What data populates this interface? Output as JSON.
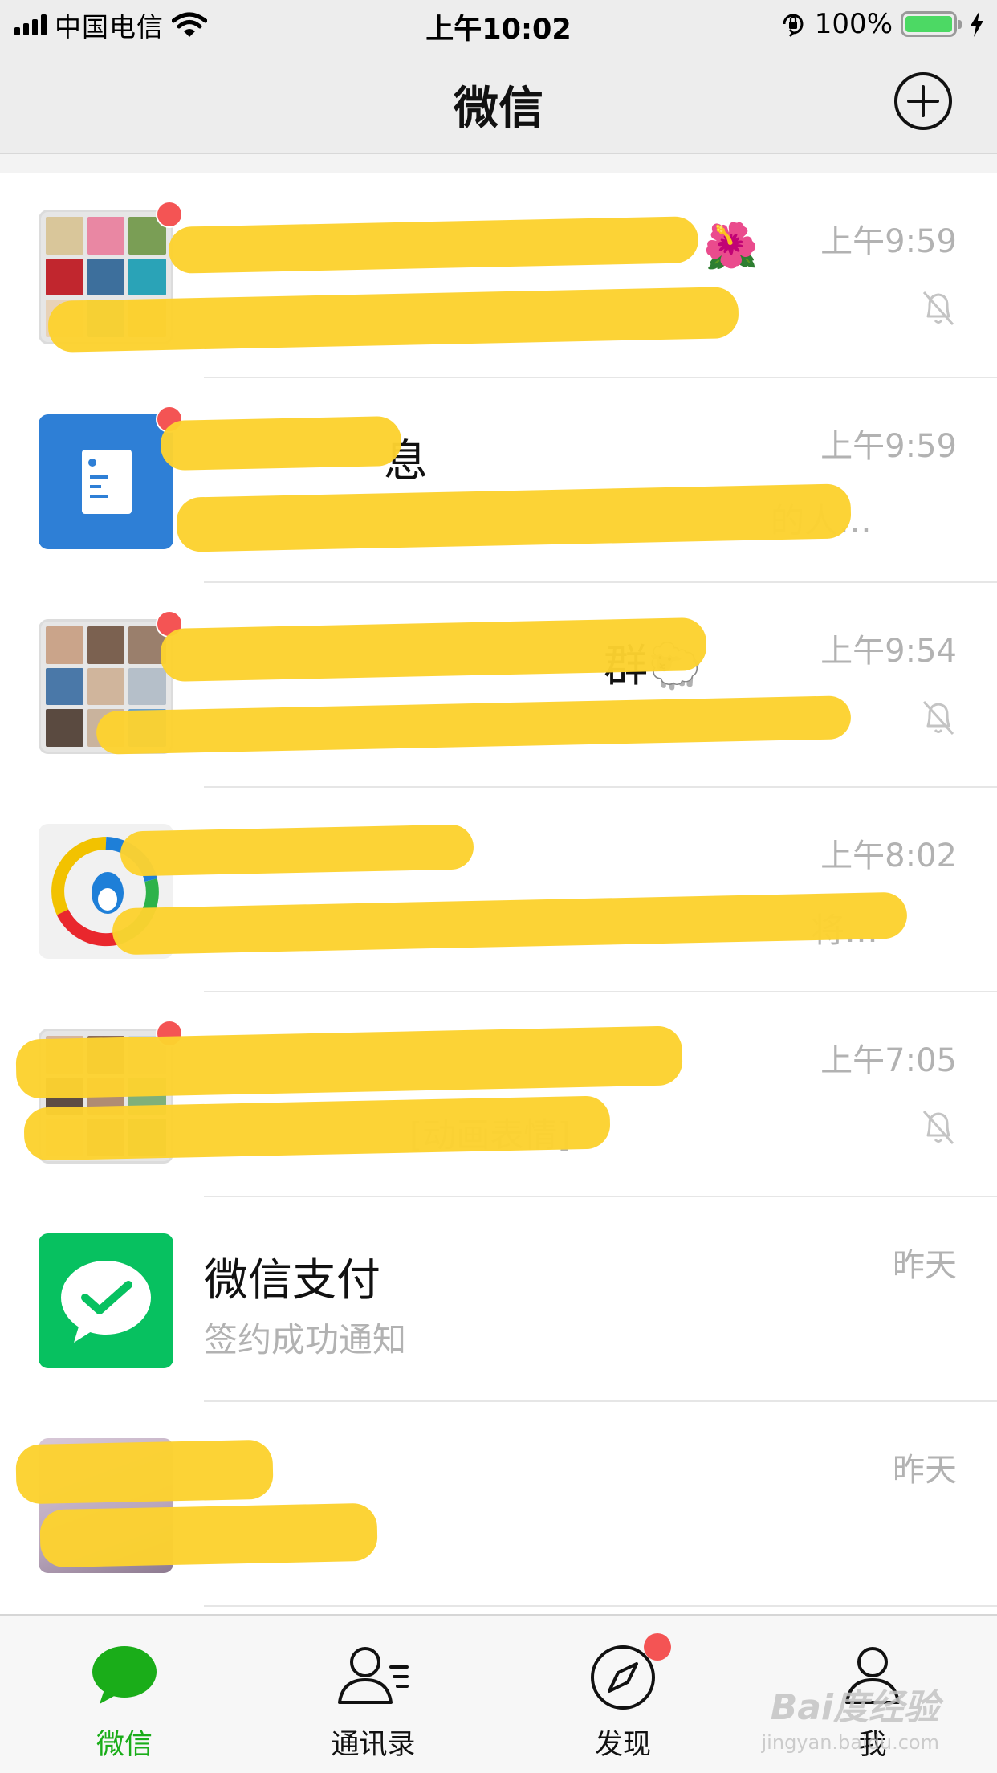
{
  "status_bar": {
    "carrier": "中国电信",
    "time": "上午10:02",
    "battery_percent": "100%",
    "icons": [
      "signal-icon",
      "wifi-icon",
      "orientation-lock-icon",
      "battery-icon",
      "charging-bolt-icon"
    ]
  },
  "header": {
    "title": "微信",
    "add_button_icon": "plus-circle-icon"
  },
  "chats": [
    {
      "name": "🌺",
      "preview": "",
      "time": "上午9:59",
      "muted": true,
      "unread": true,
      "avatar": "group-grid"
    },
    {
      "name": "息",
      "preview": "的人…",
      "time": "上午9:59",
      "muted": false,
      "unread": true,
      "avatar": "document-icon",
      "avatar_color": "#2e7fd6"
    },
    {
      "name": "群🐑",
      "preview": "",
      "time": "上午9:54",
      "muted": true,
      "unread": true,
      "avatar": "group-grid"
    },
    {
      "name": "",
      "preview": "将…",
      "time": "上午8:02",
      "muted": false,
      "unread": false,
      "avatar": "qq-penguin-logo"
    },
    {
      "name": "",
      "preview": "[动画表情]",
      "time": "上午7:05",
      "muted": true,
      "unread": true,
      "avatar": "group-grid"
    },
    {
      "name": "微信支付",
      "preview": "签约成功通知",
      "time": "昨天",
      "muted": false,
      "unread": false,
      "avatar": "wechat-pay-icon",
      "avatar_color": "#07c160"
    },
    {
      "name": "",
      "preview": "",
      "time": "昨天",
      "muted": false,
      "unread": false,
      "avatar": "photo"
    }
  ],
  "tabs": [
    {
      "label": "微信",
      "icon": "chat-bubble-icon",
      "active": true,
      "badge": false
    },
    {
      "label": "通讯录",
      "icon": "contacts-icon",
      "active": false,
      "badge": false
    },
    {
      "label": "发现",
      "icon": "compass-icon",
      "active": false,
      "badge": true
    },
    {
      "label": "我",
      "icon": "person-icon",
      "active": false,
      "badge": false
    }
  ],
  "colors": {
    "accent": "#1aad19",
    "unread_badge": "#f45454",
    "battery": "#4cd964",
    "redaction": "#fcd22f"
  },
  "watermark": {
    "logo": "Bai度经验",
    "url": "jingyan.baidu.com"
  }
}
